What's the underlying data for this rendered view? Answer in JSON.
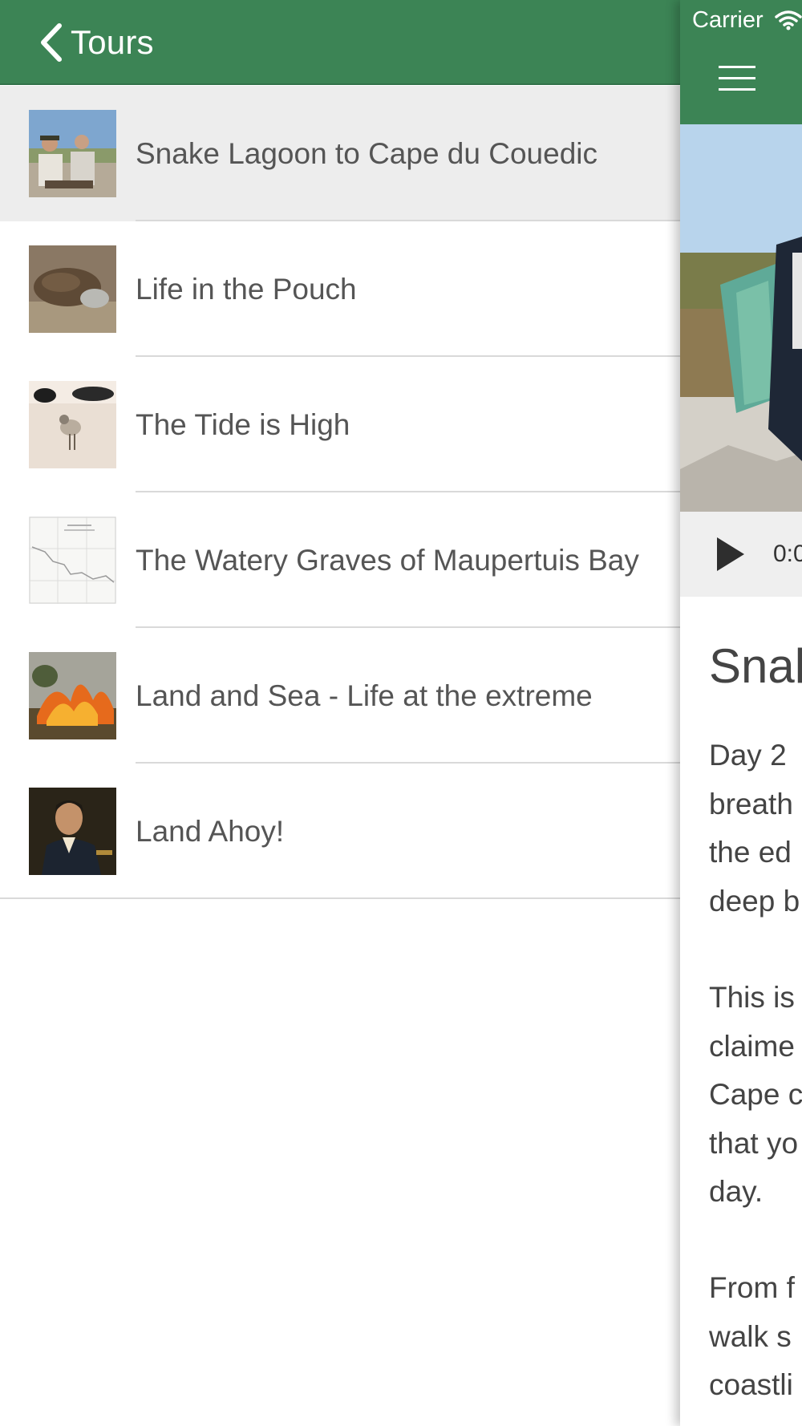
{
  "header": {
    "back_label": "Tours"
  },
  "tours": [
    {
      "title": "Snake Lagoon to Cape du Couedic",
      "thumb": "hikers-photo",
      "selected": true
    },
    {
      "title": "Life in the Pouch",
      "thumb": "platypus-photo",
      "selected": false
    },
    {
      "title": "The Tide is High",
      "thumb": "bird-on-sand-photo",
      "selected": false
    },
    {
      "title": "The Watery Graves of Maupertuis Bay",
      "thumb": "old-map-photo",
      "selected": false
    },
    {
      "title": "Land and Sea - Life at the extreme",
      "thumb": "bushfire-photo",
      "selected": false
    },
    {
      "title": "Land Ahoy!",
      "thumb": "portrait-painting-photo",
      "selected": false
    }
  ],
  "status_bar": {
    "carrier": "Carrier"
  },
  "detail": {
    "time": "0:0",
    "title": "Snak",
    "paragraphs": [
      "Day 2\nbreath\nthe ed\ndeep b",
      "This is\nclaime\nCape c\nthat yo\nday.",
      "From f\nwalk s\ncoastli"
    ]
  },
  "colors": {
    "accent_green": "#3c8455",
    "selected_row": "#ededed",
    "separator": "#d9d9d9"
  }
}
